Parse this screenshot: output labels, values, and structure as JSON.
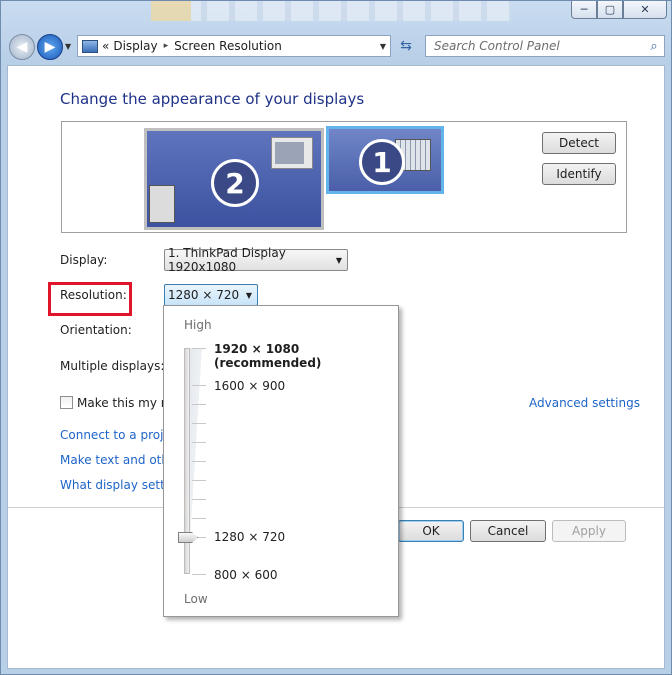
{
  "window": {
    "caption_min": "─",
    "caption_max": "▢",
    "caption_close": "✕"
  },
  "nav": {
    "back_glyph": "◀",
    "forward_glyph": "▶",
    "dropdown_glyph": "▼",
    "breadcrumb": [
      "Display",
      "Screen Resolution"
    ],
    "crumb_prefix": "«",
    "crumb_sep": "▸",
    "refresh_glyph": "⇆",
    "search_placeholder": "Search Control Panel",
    "search_glyph": "⌕",
    "icons": [
      "control-panel-icon",
      "search-icon",
      "refresh-icon"
    ]
  },
  "main": {
    "heading": "Change the appearance of your displays",
    "monitors": [
      {
        "number": "2",
        "selected": false
      },
      {
        "number": "1",
        "selected": true
      }
    ],
    "detect_label": "Detect",
    "identify_label": "Identify",
    "display_label": "Display:",
    "display_value": "1. ThinkPad Display 1920x1080",
    "resolution_label": "Resolution:",
    "resolution_value": "1280 × 720",
    "orientation_label": "Orientation:",
    "multiple_displays_label": "Multiple displays:",
    "make_main_label": "Make this my ma",
    "advanced_link": "Advanced settings",
    "links": [
      "Connect to a projec",
      "Make text and other",
      "What display setting"
    ],
    "ok_label": "OK",
    "cancel_label": "Cancel",
    "apply_label": "Apply",
    "dropdown_arrow": "▼"
  },
  "resolution_popup": {
    "high_label": "High",
    "low_label": "Low",
    "options": [
      {
        "label": "1920 × 1080 (recommended)",
        "bold": true
      },
      {
        "label": "1600 × 900",
        "bold": false
      },
      {
        "label": "1280 × 720",
        "bold": false
      },
      {
        "label": "800 × 600",
        "bold": false
      }
    ],
    "selected_index": 2
  },
  "colors": {
    "heading": "#1e3287",
    "link": "#1e64c8",
    "highlight_box": "#e0142a",
    "selected_monitor_border": "#62b4ea"
  }
}
